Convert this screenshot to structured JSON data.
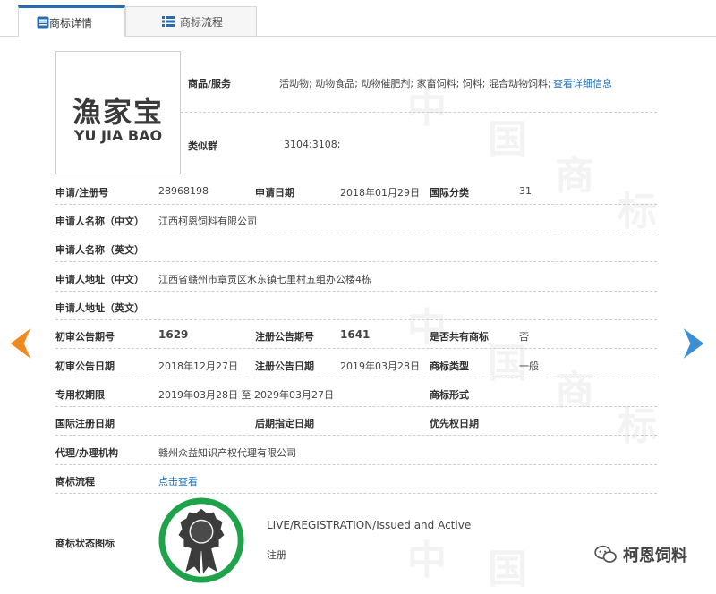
{
  "tabs": [
    {
      "label": "商标详情",
      "active": true
    },
    {
      "label": "商标流程",
      "active": false
    }
  ],
  "logo": {
    "cn": "漁家宝",
    "en": "YU JIA BAO"
  },
  "goods": {
    "label": "商品/服务",
    "value": "活动物; 动物食品; 动物催肥剂; 家畜饲料; 饲料; 混合动物饲料;",
    "more": "查看详细信息"
  },
  "similar": {
    "label": "类似群",
    "value": "3104;3108;"
  },
  "fields": {
    "reg_no_label": "申请/注册号",
    "reg_no": "28968198",
    "app_date_label": "申请日期",
    "app_date": "2018年01月29日",
    "intl_class_label": "国际分类",
    "intl_class": "31",
    "applicant_cn_label": "申请人名称（中文）",
    "applicant_cn": "江西柯恩饲料有限公司",
    "applicant_en_label": "申请人名称（英文）",
    "address_cn_label": "申请人地址（中文）",
    "address_cn": "江西省赣州市章贡区水东镇七里村五组办公楼4栋",
    "address_en_label": "申请人地址（英文）",
    "prelim_no_label": "初审公告期号",
    "prelim_no": "1629",
    "reg_pub_no_label": "注册公告期号",
    "reg_pub_no": "1641",
    "shared_label": "是否共有商标",
    "shared": "否",
    "prelim_date_label": "初审公告日期",
    "prelim_date": "2018年12月27日",
    "reg_pub_date_label": "注册公告日期",
    "reg_pub_date": "2019年03月28日",
    "tm_type_label": "商标类型",
    "tm_type": "一般",
    "term_label": "专用权期限",
    "term": "2019年03月28日 至 2029年03月27日",
    "tm_form_label": "商标形式",
    "intl_reg_date_label": "国际注册日期",
    "later_date_label": "后期指定日期",
    "priority_label": "优先权日期",
    "agent_label": "代理/办理机构",
    "agent": "赣州众益知识产权代理有限公司",
    "flow_label": "商标流程",
    "flow_link": "点击查看",
    "status_icon_label": "商标状态图标",
    "status_en": "LIVE/REGISTRATION/Issued and Active",
    "status_cn": "注册"
  },
  "watermark": {
    "text": "柯恩饲料"
  },
  "colors": {
    "accent": "#2b6cb0",
    "link": "#1f6fbf",
    "badge_green": "#1fa34a",
    "arrow_left": "#f08a1c",
    "arrow_right": "#3b8fd6"
  }
}
